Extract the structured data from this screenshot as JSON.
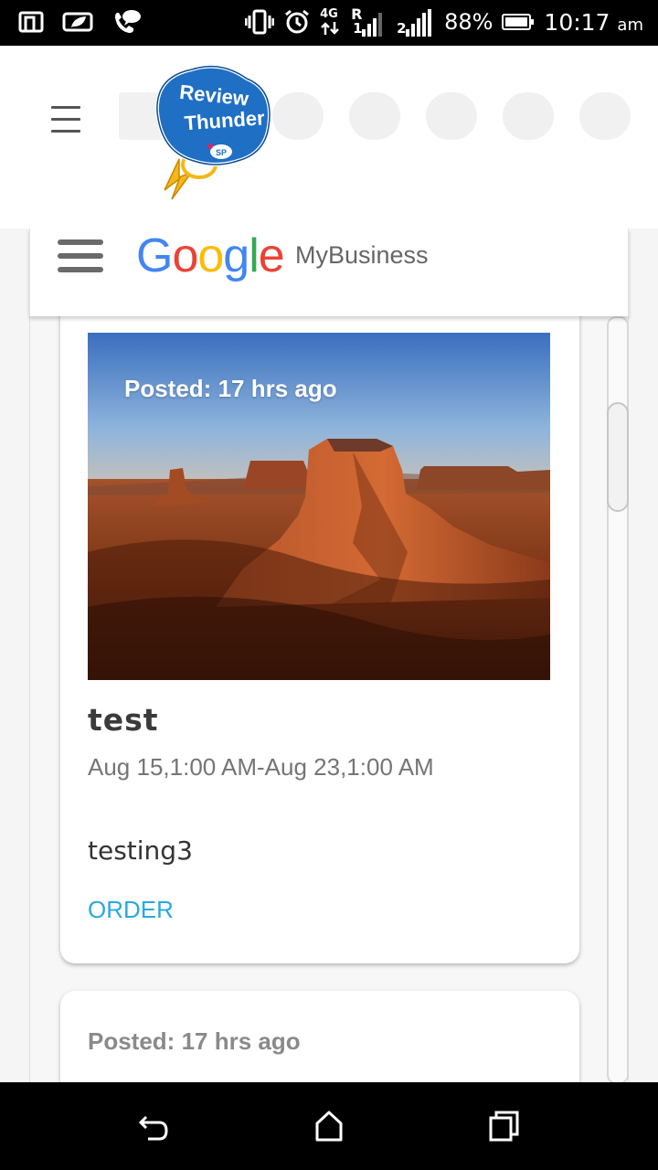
{
  "status_bar": {
    "battery": "88%",
    "time": "10:17",
    "ampm": "am",
    "network": "4G",
    "roaming": "R",
    "sim2": "2",
    "sim1": "1"
  },
  "header": {
    "logo_line1": "Review",
    "logo_line2": "Thunder",
    "logo_badge": "SP"
  },
  "gmb": {
    "brand": "Google",
    "product": "MyBusiness"
  },
  "posts": [
    {
      "posted": "Posted: 17 hrs ago",
      "title": "test",
      "dates": "Aug 15,1:00 AM-Aug 23,1:00 AM",
      "description": "testing3",
      "action": "ORDER"
    },
    {
      "posted": "Posted: 17 hrs ago"
    }
  ],
  "colors": {
    "order_link": "#29a9e0",
    "logo_blue": "#1f6fc4",
    "google_blue": "#4285F4",
    "google_red": "#EA4335",
    "google_yellow": "#FBBC05",
    "google_green": "#34A853"
  },
  "icons": {
    "nav_back": "back-icon",
    "nav_home": "home-icon",
    "nav_recents": "recents-icon"
  }
}
